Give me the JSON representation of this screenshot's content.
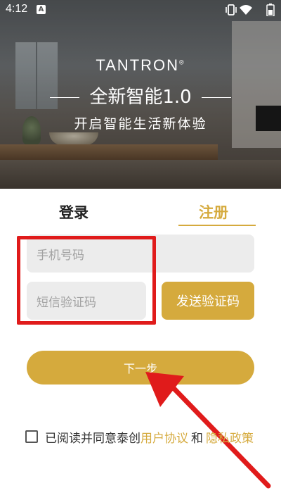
{
  "status_bar": {
    "time": "4:12",
    "notification_glyph": "A",
    "icons": [
      "notification-icon",
      "vibrate-icon",
      "wifi-icon",
      "battery-icon"
    ]
  },
  "hero": {
    "brand": "TANTRON",
    "brand_mark": "®",
    "headline": "全新智能1.0",
    "subline": "开启智能生活新体验"
  },
  "tabs": [
    {
      "label": "登录",
      "active": false
    },
    {
      "label": "注册",
      "active": true
    }
  ],
  "form": {
    "phone_placeholder": "手机号码",
    "code_placeholder": "短信验证码",
    "send_code_label": "发送验证码",
    "next_label": "下一步"
  },
  "agreement": {
    "prefix": "已阅读并同意泰创",
    "user_agreement": "用户协议",
    "conjunction": "和",
    "privacy_policy": "隐私政策"
  },
  "colors": {
    "accent": "#d5aa3d",
    "annotation": "#e01b1b",
    "input_background": "#ececec"
  }
}
